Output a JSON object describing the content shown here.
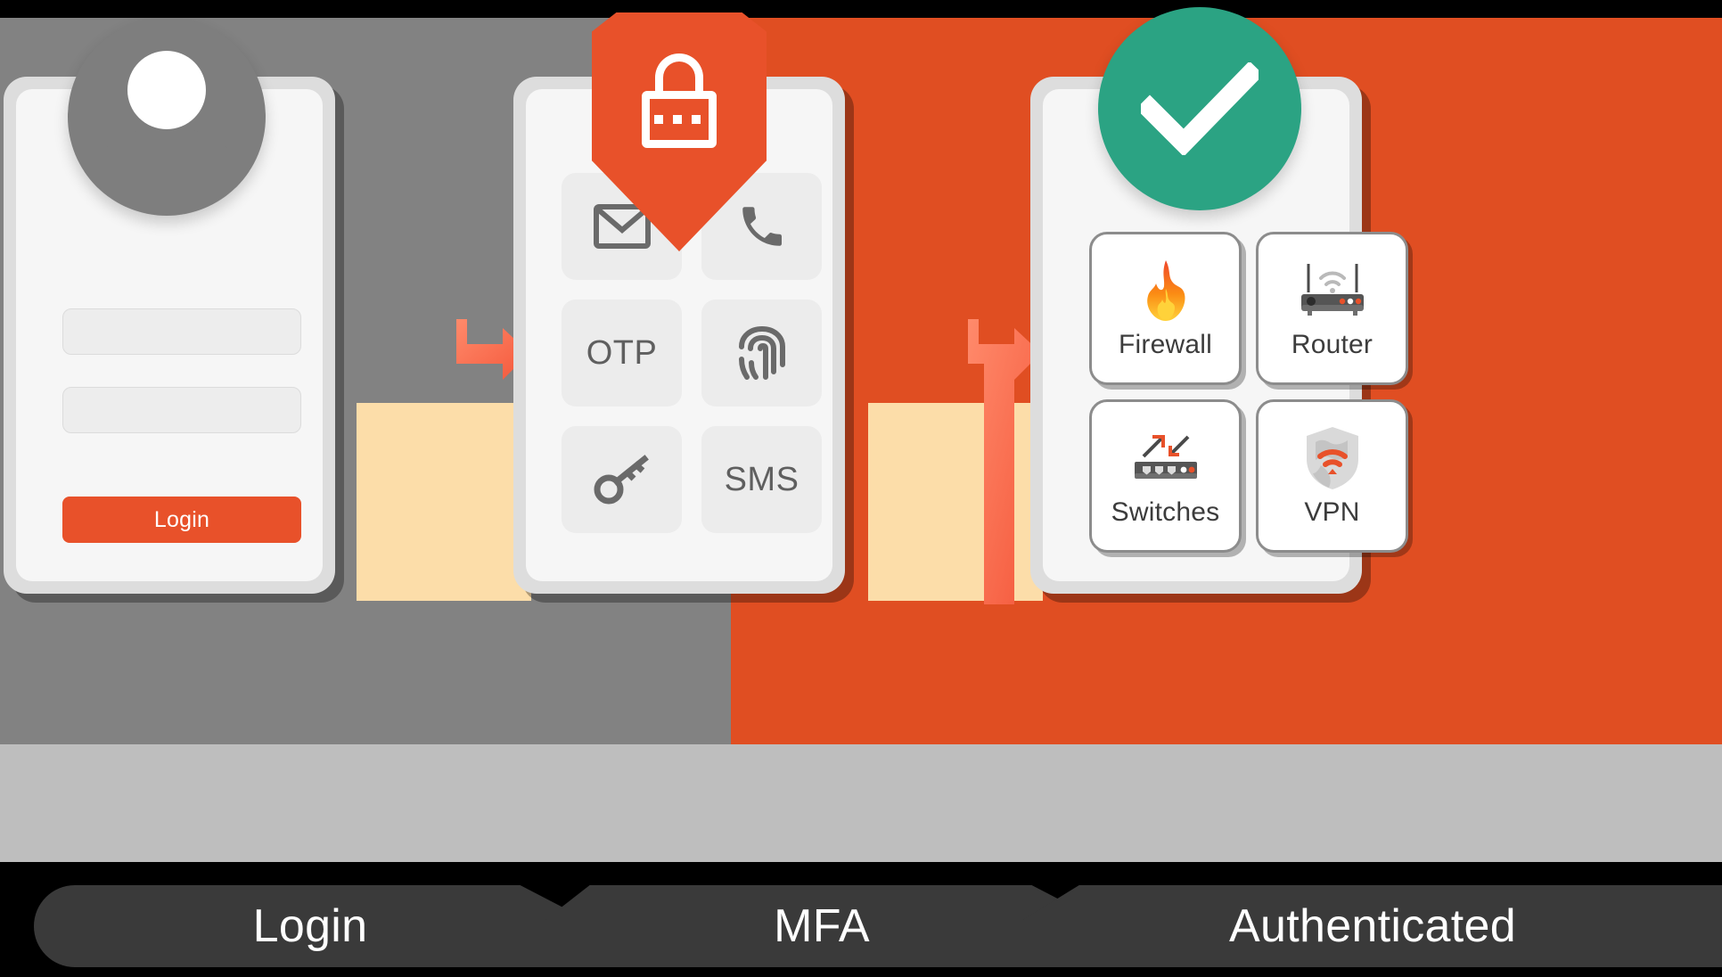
{
  "diagram": {
    "title": "Login to MFA to Authenticated flow",
    "colors": {
      "orange": "#E04E22",
      "orange_button": "#E8512A",
      "coral_arrow": "#FC6A4F",
      "bar_cream": "#FCDDA9",
      "gray_panel": "#828282",
      "base_gray": "#BEBEBE",
      "step_dark": "#3A3A3A",
      "success_green": "#2BA383",
      "avatar_gray": "#7E7E7E"
    }
  },
  "login_card": {
    "avatar_icon": "user-avatar-icon",
    "username_placeholder": "",
    "password_placeholder": "",
    "button_label": "Login"
  },
  "mfa_card": {
    "shield_icon": "shield-lock-icon",
    "methods": [
      {
        "icon": "email-icon",
        "label": ""
      },
      {
        "icon": "phone-icon",
        "label": ""
      },
      {
        "icon": "otp-text",
        "label": "OTP"
      },
      {
        "icon": "fingerprint-icon",
        "label": ""
      },
      {
        "icon": "key-icon",
        "label": ""
      },
      {
        "icon": "sms-text",
        "label": "SMS"
      }
    ]
  },
  "auth_card": {
    "status_icon": "check-circle-icon",
    "devices": [
      {
        "icon": "flame-icon",
        "label": "Firewall"
      },
      {
        "icon": "router-icon",
        "label": "Router"
      },
      {
        "icon": "switch-icon",
        "label": "Switches"
      },
      {
        "icon": "vpn-shield-icon",
        "label": "VPN"
      }
    ]
  },
  "steps": [
    {
      "label": "Login"
    },
    {
      "label": "MFA"
    },
    {
      "label": "Authenticated"
    }
  ]
}
